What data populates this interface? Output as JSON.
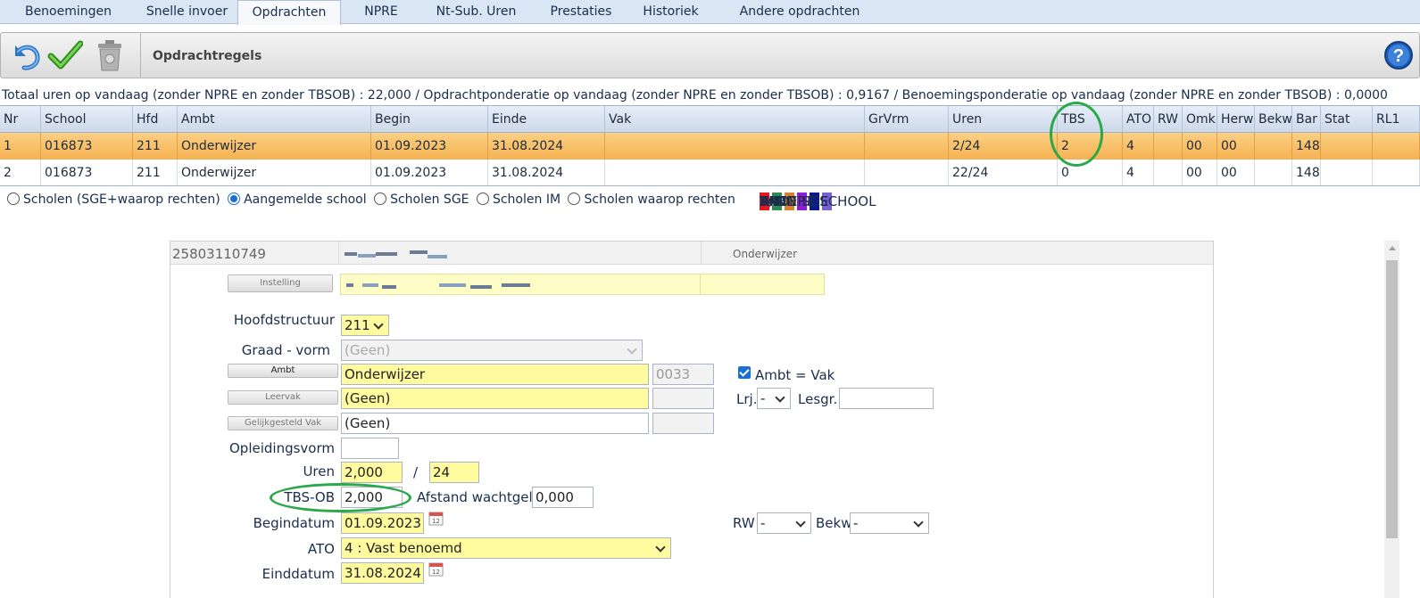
{
  "tabs": [
    {
      "label": "Benoemingen"
    },
    {
      "label": "Snelle invoer"
    },
    {
      "label": "Opdrachten"
    },
    {
      "label": "NPRE"
    },
    {
      "label": "Nt-Sub. Uren"
    },
    {
      "label": "Prestaties"
    },
    {
      "label": "Historiek"
    },
    {
      "label": "Andere opdrachten"
    }
  ],
  "toolbar": {
    "title": "Opdrachtregels",
    "icons": [
      "undo-icon",
      "check-icon",
      "trash-icon",
      "help-icon"
    ]
  },
  "summary": "Totaal uren op vandaag (zonder NPRE en zonder TBSOB) : 22,000 / Opdrachtponderatie op vandaag (zonder NPRE en zonder TBSOB) : 0,9167 / Benoemingsponderatie op vandaag (zonder NPRE en zonder TBSOB) : 0,0000",
  "grid": {
    "columns": [
      "Nr",
      "School",
      "Hfd",
      "Ambt",
      "Begin",
      "Einde",
      "Vak",
      "GrVrm",
      "Uren",
      "TBS",
      "ATO",
      "RW",
      "Omk",
      "Herw",
      "Bekw",
      "Bar",
      "Stat",
      "RL1"
    ],
    "rows": [
      [
        "1",
        "016873",
        "211",
        "Onderwijzer",
        "01.09.2023",
        "31.08.2024",
        "",
        "",
        "2/24",
        "2",
        "4",
        "",
        "00",
        "00",
        "",
        "148",
        "",
        ""
      ],
      [
        "2",
        "016873",
        "211",
        "Onderwijzer",
        "01.09.2023",
        "31.08.2024",
        "",
        "",
        "22/24",
        "0",
        "4",
        "",
        "00",
        "00",
        "",
        "148",
        "",
        ""
      ]
    ]
  },
  "school_filter": {
    "options": [
      "Scholen (SGE+waarop rechten)",
      "Aangemelde school",
      "Scholen SGE",
      "Scholen IM",
      "Scholen waarop rechten"
    ],
    "selected": "Aangemelde school"
  },
  "legend": [
    {
      "label": "TADD",
      "color": "#e8141e"
    },
    {
      "label": "TAO",
      "color": "#2e8b57"
    },
    {
      "label": "R/W",
      "color": "#d9822b"
    },
    {
      "label": "VKA",
      "color": "#8a1fd6"
    },
    {
      "label": "UREN SGE",
      "color": "#0b1a8c"
    },
    {
      "label": "ANDERE SCHOOL",
      "color": "#7a5fd6"
    }
  ],
  "form": {
    "header_id": "25803110749",
    "header_ambt": "Onderwijzer",
    "instelling_button": "Instelling",
    "hoofdstructuur_label": "Hoofdstructuur",
    "hoofdstructuur_value": "211",
    "graad_label": "Graad - vorm",
    "graad_value": "(Geen)",
    "ambt_button": "Ambt",
    "ambt_value": "Onderwijzer",
    "ambt_code": "0033",
    "ambt_eq_vak_label": "Ambt = Vak",
    "leervak_button": "Leervak",
    "leervak_value": "(Geen)",
    "lrj_label": "Lrj.",
    "lrj_value": "-",
    "lesgr_label": "Lesgr.",
    "gelijk_button": "Gelijkgesteld Vak",
    "gelijk_value": "(Geen)",
    "opleidingsvorm_label": "Opleidingsvorm",
    "uren_label": "Uren",
    "uren_value": "2,000",
    "uren_slash": "/",
    "uren_total": "24",
    "tbsob_label": "TBS-OB",
    "tbsob_value": "2,000",
    "afstand_label": "Afstand wachtgeld",
    "afstand_value": "0,000",
    "begindatum_label": "Begindatum",
    "begindatum_value": "01.09.2023",
    "rw_label": "RW",
    "rw_value": "-",
    "bekw_label": "Bekw",
    "bekw_value": "-",
    "ato_label": "ATO",
    "ato_value": "4 : Vast benoemd",
    "einddatum_label": "Einddatum",
    "einddatum_value": "31.08.2024"
  }
}
